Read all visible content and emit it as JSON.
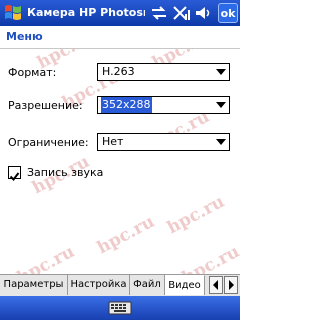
{
  "titlebar": {
    "title": "Камера HP Photosma",
    "ok_label": "ok",
    "icons": [
      "windows-start-icon",
      "connectivity-icon",
      "signal-off-icon",
      "volume-icon"
    ]
  },
  "menubar": {
    "label": "Меню"
  },
  "form": {
    "format": {
      "label": "Формат:",
      "value": "H.263"
    },
    "resolution": {
      "label": "Разрешение:",
      "value": "352x288"
    },
    "limit": {
      "label": "Ограничение:",
      "value": "Нет"
    },
    "audio": {
      "label": "Запись звука",
      "checked": true
    }
  },
  "tabs": [
    {
      "label": "Параметры",
      "active": false
    },
    {
      "label": "Настройка",
      "active": false
    },
    {
      "label": "Файл",
      "active": false
    },
    {
      "label": "Видео",
      "active": true
    }
  ],
  "watermark": "hpc.ru",
  "colors": {
    "accent": "#2a5bd7",
    "title_bar": "#0d3aa8",
    "menu_text": "#1f4fbf"
  }
}
